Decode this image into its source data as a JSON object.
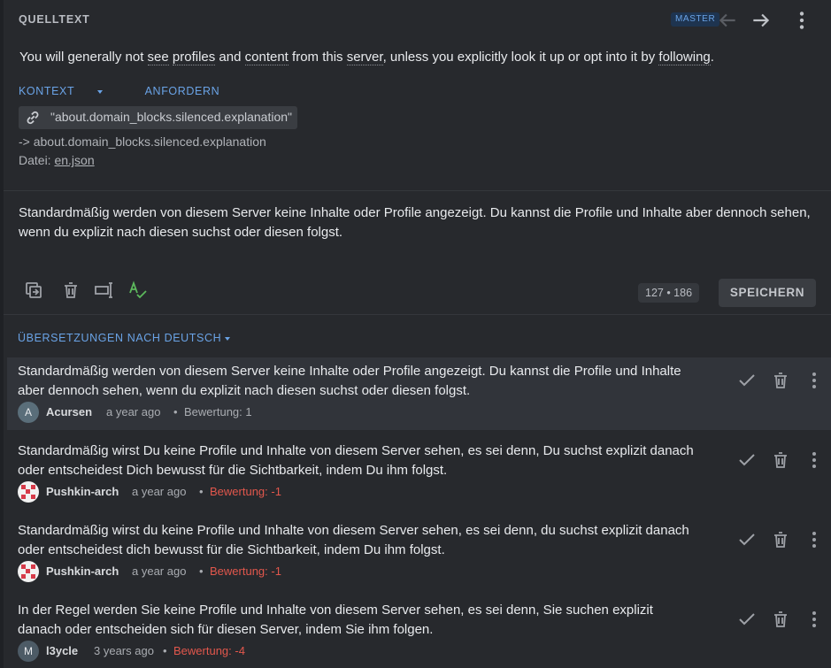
{
  "header": {
    "title": "QUELLTEXT",
    "branch": "MASTER",
    "prev_icon": "arrow-left-icon",
    "next_icon": "arrow-right-icon",
    "more_icon": "more-vertical-icon"
  },
  "source": {
    "parts": [
      "You will generally not ",
      "see",
      " ",
      "profiles",
      " and ",
      "content",
      " from this ",
      "server",
      ", unless you explicitly look it up or opt into it by ",
      "following",
      "."
    ],
    "context_label": "KONTEXT",
    "request_label": "ANFORDERN",
    "key": "\"about.domain_blocks.silenced.explanation\"",
    "key_icon": "link-icon",
    "key_path": "-> about.domain_blocks.silenced.explanation",
    "file_label": "Datei:",
    "file_name": "en.json"
  },
  "target": {
    "text": "Standardmäßig werden von diesem Server keine Inhalte oder Profile angezeigt. Du kannst die Profile und Inhalte aber dennoch sehen, wenn du explizit nach diesen suchst oder diesen folgst."
  },
  "toolbar": {
    "icons": [
      "copy-source-icon",
      "delete-icon",
      "text-cursor-icon",
      "spellcheck-icon"
    ],
    "counter": "127 • 186",
    "save_label": "SPEICHERN"
  },
  "translations": {
    "heading": "ÜBERSETZUNGEN NACH DEUTSCH",
    "items": [
      {
        "text": "Standardmäßig werden von diesem Server keine Inhalte oder Profile angezeigt. Du kannst die Profile und Inhalte aber dennoch sehen, wenn du explizit nach diesen suchst oder diesen folgst.",
        "user": "Acursen",
        "avatar_letter": "A",
        "time": "a year ago",
        "score": "Bewertung: 1",
        "negative": false
      },
      {
        "text": "Standardmäßig wirst Du keine Profile und Inhalte von diesem Server sehen, es sei denn, Du suchst explizit danach oder entscheidest Dich bewusst für die Sichtbarkeit, indem Du ihm folgst.",
        "user": "Pushkin-arch",
        "avatar_letter": "",
        "time": "a year ago",
        "score": "Bewertung: -1",
        "negative": true
      },
      {
        "text": "Standardmäßig wirst du keine Profile und Inhalte von diesem Server sehen, es sei denn, du suchst explizit danach oder entscheidest dich bewusst für die Sichtbarkeit, indem Du ihm folgst.",
        "user": "Pushkin-arch",
        "avatar_letter": "",
        "time": "a year ago",
        "score": "Bewertung: -1",
        "negative": true
      },
      {
        "text": "In der Regel werden Sie keine Profile und Inhalte von diesem Server sehen, es sei denn, Sie suchen explizit danach oder entscheiden sich für diesen Server, indem Sie ihm folgen.",
        "user": "l3ycle",
        "avatar_letter": "M",
        "time": "3 years ago",
        "score": "Bewertung: -4",
        "negative": true
      }
    ]
  },
  "colors": {
    "accent": "#6aa3e6",
    "negative": "#e2574c",
    "spellcheck": "#5cb85c"
  }
}
